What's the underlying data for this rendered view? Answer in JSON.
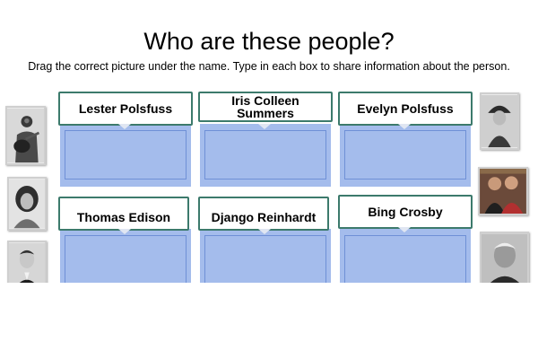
{
  "page": {
    "title": "Who are these people?",
    "instructions": "Drag the correct picture under the name. Type in each box to share information about the person."
  },
  "names": [
    {
      "label": "Lester Polsfuss"
    },
    {
      "label": "Iris Colleen Summers"
    },
    {
      "label": "Evelyn Polsfuss"
    },
    {
      "label": "Thomas Edison"
    },
    {
      "label": "Django Reinhardt"
    },
    {
      "label": "Bing Crosby"
    }
  ],
  "photos": [
    {
      "icon": "man-with-guitar-photo-icon",
      "tone": "sepia-gray"
    },
    {
      "icon": "woman-portrait-photo-icon",
      "tone": "gray"
    },
    {
      "icon": "man-portrait-photo-icon",
      "tone": "gray"
    },
    {
      "icon": "girl-with-hat-photo-icon",
      "tone": "gray"
    },
    {
      "icon": "two-men-color-photo-icon",
      "tone": "color"
    },
    {
      "icon": "elderly-man-photo-icon",
      "tone": "gray"
    }
  ],
  "colors": {
    "label_border": "#3c7a6c",
    "drop_fill": "#a4bcec",
    "drop_border": "#6f90d6"
  }
}
